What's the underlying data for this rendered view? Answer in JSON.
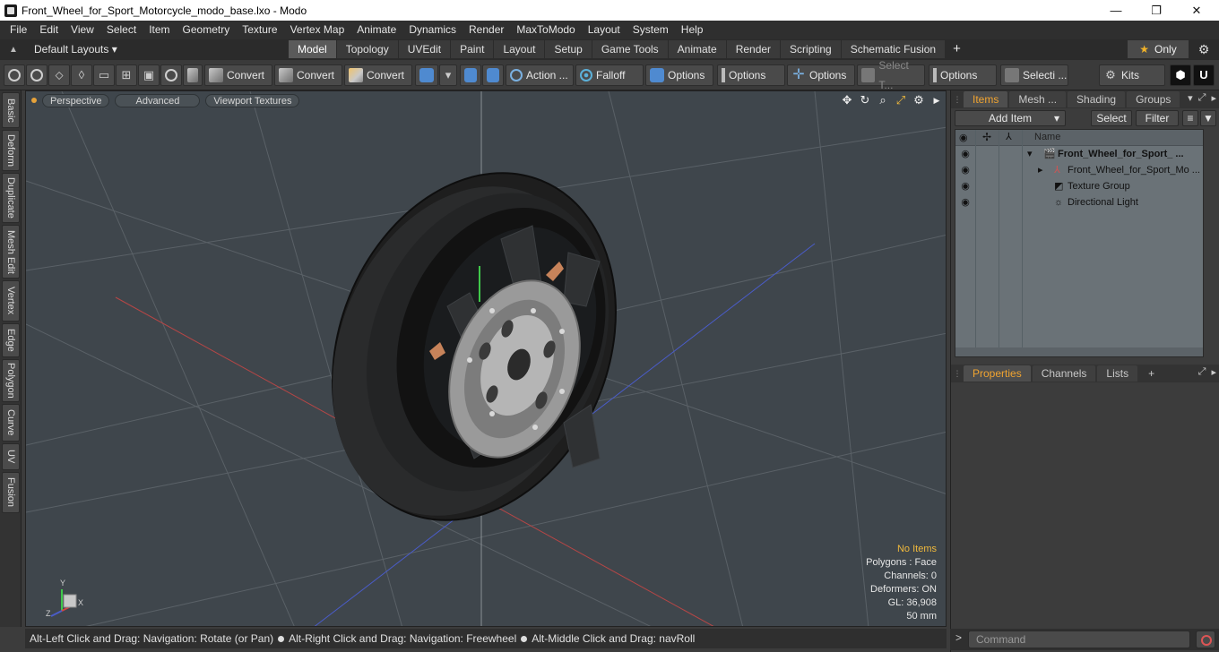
{
  "window": {
    "title": "Front_Wheel_for_Sport_Motorcycle_modo_base.lxo - Modo",
    "minimize": "—",
    "maximize": "❐",
    "close": "✕"
  },
  "menu": [
    "File",
    "Edit",
    "View",
    "Select",
    "Item",
    "Geometry",
    "Texture",
    "Vertex Map",
    "Animate",
    "Dynamics",
    "Render",
    "MaxToModo",
    "Layout",
    "System",
    "Help"
  ],
  "layouts": {
    "label": "Default Layouts ▾"
  },
  "tabs": [
    "Model",
    "Topology",
    "UVEdit",
    "Paint",
    "Layout",
    "Setup",
    "Game Tools",
    "Animate",
    "Render",
    "Scripting",
    "Schematic Fusion"
  ],
  "active_tab": "Model",
  "only_label": "Only",
  "toolbar": {
    "convert1": "Convert",
    "convert2": "Convert",
    "convert3": "Convert",
    "action": "Action ...",
    "falloff": "Falloff",
    "options1": "Options",
    "options2": "Options",
    "options3": "Options",
    "select_t": "Select T...",
    "options4": "Options",
    "selecti": "Selecti ...",
    "kits": "Kits"
  },
  "left_tabs": [
    "Basic",
    "Deform",
    "Duplicate",
    "Mesh Edit",
    "Vertex",
    "Edge",
    "Polygon",
    "Curve",
    "UV",
    "Fusion"
  ],
  "viewport": {
    "perspective": "Perspective",
    "advanced": "Advanced",
    "textures": "Viewport Textures",
    "hud": {
      "no_items": "No Items",
      "polygons": "Polygons : Face",
      "channels": "Channels: 0",
      "deformers": "Deformers: ON",
      "gl": "GL: 36,908",
      "scale": "50 mm"
    },
    "axis_y": "Y",
    "axis_x": "X",
    "axis_z": "Z"
  },
  "status": {
    "part1": "Alt-Left Click and Drag: Navigation: Rotate (or Pan)",
    "part2": "Alt-Right Click and Drag: Navigation: Freewheel",
    "part3": "Alt-Middle Click and Drag: navRoll"
  },
  "items_panel": {
    "tabs": [
      "Items",
      "Mesh ...",
      "Shading",
      "Groups"
    ],
    "add_item": "Add Item",
    "select": "Select",
    "filter": "Filter",
    "name_col": "Name",
    "rows": [
      {
        "label": "Front_Wheel_for_Sport_ ..."
      },
      {
        "label": "Front_Wheel_for_Sport_Mo ..."
      },
      {
        "label": "Texture Group"
      },
      {
        "label": "Directional Light"
      }
    ]
  },
  "props_panel": {
    "tabs": [
      "Properties",
      "Channels",
      "Lists"
    ],
    "add": "+"
  },
  "command": {
    "placeholder": "Command",
    "prompt": ">"
  }
}
